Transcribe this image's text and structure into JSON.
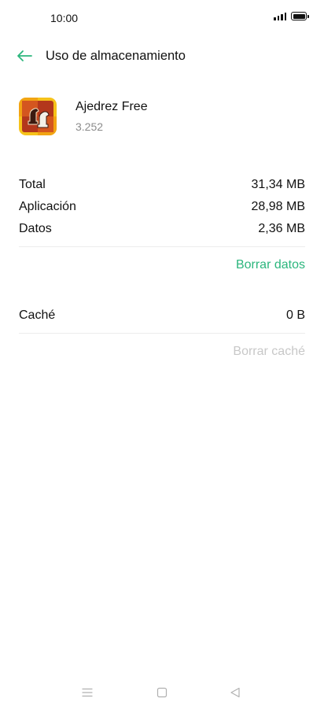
{
  "status_bar": {
    "time": "10:00"
  },
  "header": {
    "title": "Uso de almacenamiento"
  },
  "app": {
    "name": "Ajedrez Free",
    "version": "3.252"
  },
  "storage": {
    "rows": [
      {
        "label": "Total",
        "value": "31,34 MB"
      },
      {
        "label": "Aplicación",
        "value": "28,98 MB"
      },
      {
        "label": "Datos",
        "value": "2,36 MB"
      }
    ],
    "clear_data_label": "Borrar datos"
  },
  "cache": {
    "label": "Caché",
    "value": "0 B",
    "clear_cache_label": "Borrar caché"
  },
  "colors": {
    "accent": "#2cb67d",
    "disabled": "#c8c8c8"
  },
  "nav_icons": [
    "menu-icon",
    "home-icon",
    "back-icon"
  ]
}
